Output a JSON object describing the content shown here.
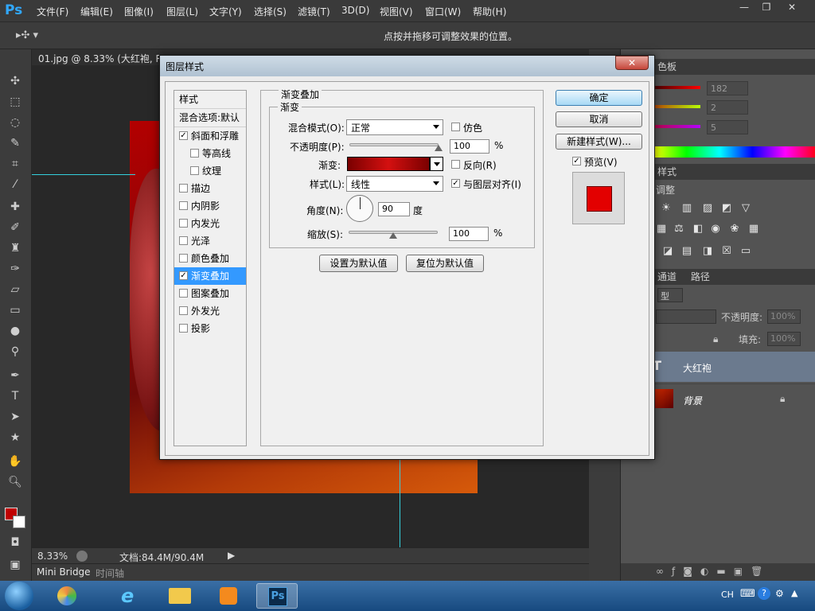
{
  "app": {
    "logo": "Ps"
  },
  "menu": [
    "文件(F)",
    "编辑(E)",
    "图像(I)",
    "图层(L)",
    "文字(Y)",
    "选择(S)",
    "滤镜(T)",
    "3D(D)",
    "视图(V)",
    "窗口(W)",
    "帮助(H)"
  ],
  "options_bar": {
    "hint": "点按并拖移可调整效果的位置。"
  },
  "document": {
    "tab": "01.jpg @ 8.33% (大红袍, RG",
    "zoom": "8.33%",
    "info": "文档:84.4M/90.4M"
  },
  "bottom_tabs": {
    "mini_bridge": "Mini Bridge",
    "timeline": "时间轴"
  },
  "color_panel": {
    "title": "色板",
    "channels": [
      {
        "label": "R",
        "value": "182"
      },
      {
        "label": "G",
        "value": "2"
      },
      {
        "label": "B",
        "value": "5"
      }
    ]
  },
  "styles_panel": {
    "title": "样式",
    "adjust_label": "调整"
  },
  "layers_panel": {
    "tabs": [
      "通道",
      "路径"
    ],
    "kind_label": "型",
    "opacity_label": "不透明度:",
    "opacity_value": "100%",
    "fill_label": "填充:",
    "fill_value": "100%",
    "layers": [
      {
        "name": "大红袍",
        "type": "text"
      },
      {
        "name": "背景",
        "type": "image"
      }
    ]
  },
  "dialog": {
    "title": "图层样式",
    "close": "✕",
    "style_header": "样式",
    "blend_options": "混合选项:默认",
    "styles": [
      {
        "label": "斜面和浮雕",
        "checked": true,
        "indent": false
      },
      {
        "label": "等高线",
        "checked": false,
        "indent": true
      },
      {
        "label": "纹理",
        "checked": false,
        "indent": true
      },
      {
        "label": "描边",
        "checked": false,
        "indent": false
      },
      {
        "label": "内阴影",
        "checked": false,
        "indent": false
      },
      {
        "label": "内发光",
        "checked": false,
        "indent": false
      },
      {
        "label": "光泽",
        "checked": false,
        "indent": false
      },
      {
        "label": "颜色叠加",
        "checked": false,
        "indent": false
      },
      {
        "label": "渐变叠加",
        "checked": true,
        "indent": false,
        "selected": true
      },
      {
        "label": "图案叠加",
        "checked": false,
        "indent": false
      },
      {
        "label": "外发光",
        "checked": false,
        "indent": false
      },
      {
        "label": "投影",
        "checked": false,
        "indent": false
      }
    ],
    "group_title": "渐变叠加",
    "sub_group_title": "渐变",
    "blend_mode_label": "混合模式(O):",
    "blend_mode_value": "正常",
    "dither_label": "仿色",
    "opacity_label": "不透明度(P):",
    "opacity_value": "100",
    "opacity_level": 1.0,
    "percent": "%",
    "gradient_label": "渐变:",
    "reverse_label": "反向(R)",
    "style_label": "样式(L):",
    "style_value": "线性",
    "align_label": "与图层对齐(I)",
    "angle_label": "角度(N):",
    "angle_value": "90",
    "degree": "度",
    "scale_label": "缩放(S):",
    "scale_value": "100",
    "scale_level": 0.5,
    "set_default": "设置为默认值",
    "reset_default": "复位为默认值",
    "ok": "确定",
    "cancel": "取消",
    "new_style": "新建样式(W)...",
    "preview_label": "预览(V)"
  },
  "taskbar": {
    "lang": "CH"
  },
  "colors": {
    "accent": "#3399ff",
    "preview": "#e30000"
  }
}
